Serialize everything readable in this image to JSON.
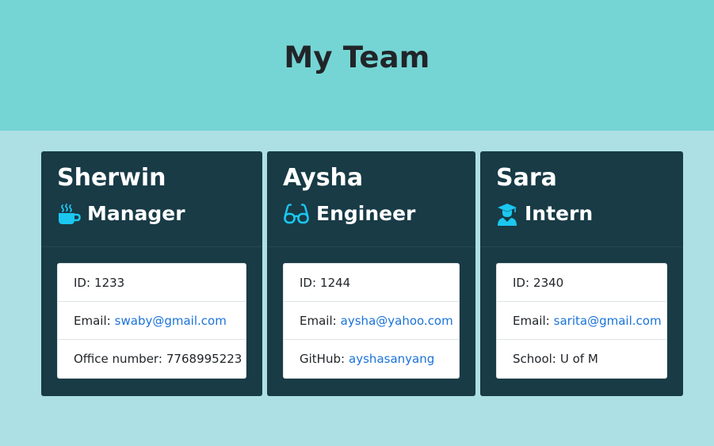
{
  "header": {
    "title": "My Team"
  },
  "colors": {
    "header_bg": "#75d5d4",
    "page_bg": "#ade0e5",
    "card_bg": "#183b46",
    "icon": "#1bc7f0",
    "link": "#1a73d9"
  },
  "employees": [
    {
      "name": "Sherwin",
      "role": "Manager",
      "icon": "coffee-icon",
      "id_label": "ID:",
      "id": "1233",
      "email_label": "Email:",
      "email": "swaby@gmail.com",
      "extra_label": "Office number:",
      "extra_value": "7768995223"
    },
    {
      "name": "Aysha",
      "role": "Engineer",
      "icon": "glasses-icon",
      "id_label": "ID:",
      "id": "1244",
      "email_label": "Email:",
      "email": "aysha@yahoo.com",
      "extra_label": "GitHub:",
      "extra_value": "ayshasanyang"
    },
    {
      "name": "Sara",
      "role": "Intern",
      "icon": "graduate-icon",
      "id_label": "ID:",
      "id": "2340",
      "email_label": "Email:",
      "email": "sarita@gmail.com",
      "extra_label": "School:",
      "extra_value": "U of M"
    }
  ]
}
